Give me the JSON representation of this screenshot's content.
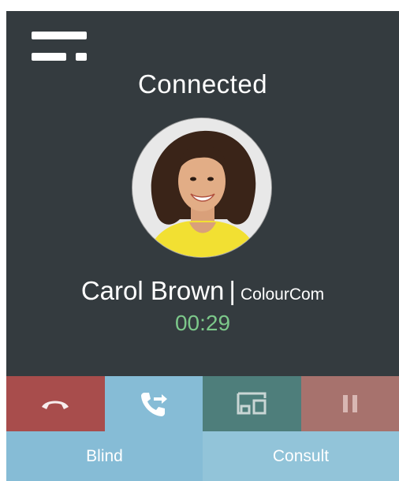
{
  "call": {
    "status": "Connected",
    "caller_name": "Carol Brown",
    "separator": "|",
    "company": "ColourCom",
    "duration": "00:29"
  },
  "actions": [
    {
      "icon": "hang-up-icon",
      "color": "#a84d4c"
    },
    {
      "icon": "transfer-call-icon",
      "color": "#86bcd6"
    },
    {
      "icon": "device-switch-icon",
      "color": "#4e7e7b"
    },
    {
      "icon": "pause-icon",
      "color": "#a7726d"
    }
  ],
  "transfer": {
    "blind_label": "Blind",
    "consult_label": "Consult"
  },
  "colors": {
    "background": "#343b3f",
    "timer": "#7cc88a"
  }
}
